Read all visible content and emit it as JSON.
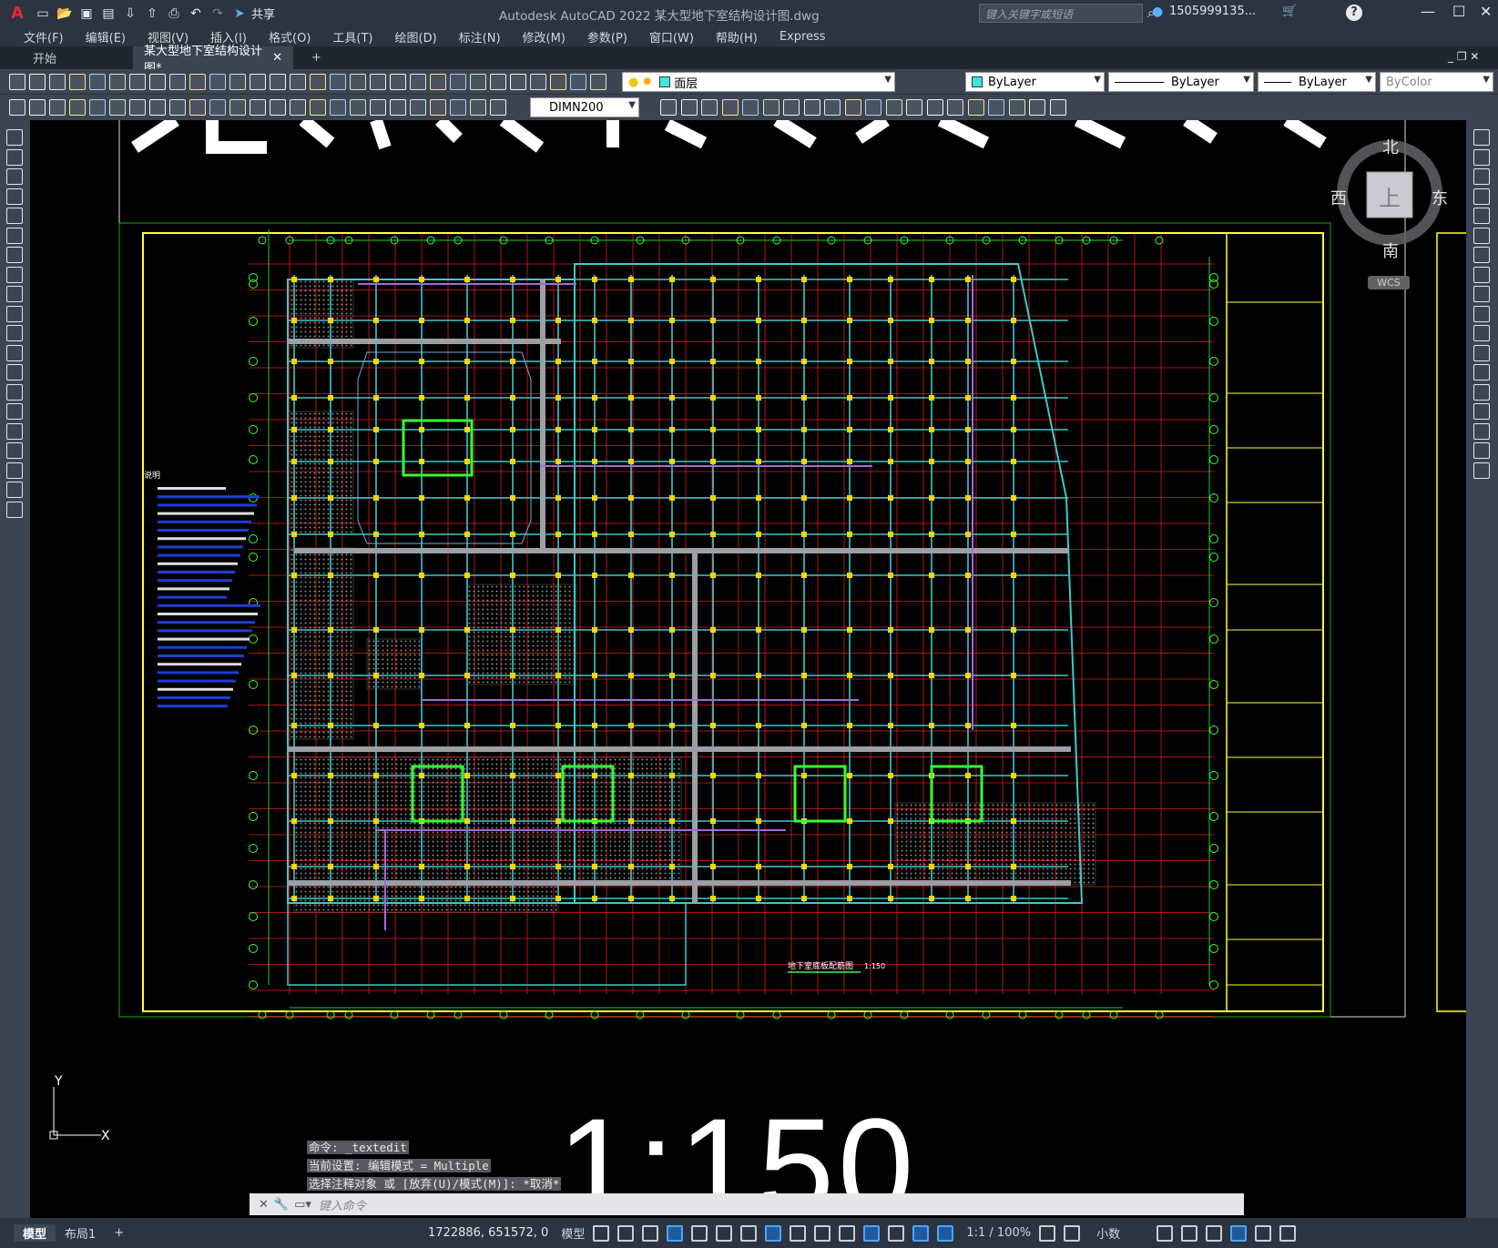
{
  "app": {
    "title": "Autodesk AutoCAD 2022    某大型地下室结构设计图.dwg",
    "search_placeholder": "键入关键字或短语",
    "user": "1505999135...",
    "share": "共享"
  },
  "menu": [
    "文件(F)",
    "编辑(E)",
    "视图(V)",
    "插入(I)",
    "格式(O)",
    "工具(T)",
    "绘图(D)",
    "标注(N)",
    "修改(M)",
    "参数(P)",
    "窗口(W)",
    "帮助(H)",
    "Express"
  ],
  "tabs": [
    {
      "label": "开始"
    },
    {
      "label": "某大型地下室结构设计图*"
    }
  ],
  "toolbar": {
    "layer": "面层",
    "color": "ByLayer",
    "linetype": "ByLayer",
    "lineweight": "ByLayer",
    "plotstyle": "ByColor",
    "dimstyle": "DIMN200"
  },
  "viewcube": {
    "n": "北",
    "s": "南",
    "e": "东",
    "w": "西",
    "top": "上",
    "wcs": "WCS"
  },
  "drawing": {
    "plan_title": "地下室底板配筋图",
    "plan_scale": "1:150",
    "big_scale": "1:150",
    "notes_title": "说明"
  },
  "command": {
    "history": [
      "命令: _textedit",
      "当前设置: 编辑模式 = Multiple",
      "选择注释对象 或 [放弃(U)/模式(M)]: *取消*"
    ],
    "placeholder": "键入命令"
  },
  "layout_tabs": [
    "模型",
    "布局1"
  ],
  "status": {
    "coords": "1722886, 651572, 0",
    "model": "模型",
    "scale": "1:1 / 100%",
    "units": "小数"
  },
  "colors": {
    "bg": "#000000",
    "chrome": "#3b4552",
    "grid_red": "#ff1a1a",
    "wall_cyan": "#3ec9c9",
    "column_yellow": "#ffd400",
    "core_green": "#33ff33",
    "beam_purple": "#a06ad8",
    "frame_yellow": "#ffff33"
  }
}
